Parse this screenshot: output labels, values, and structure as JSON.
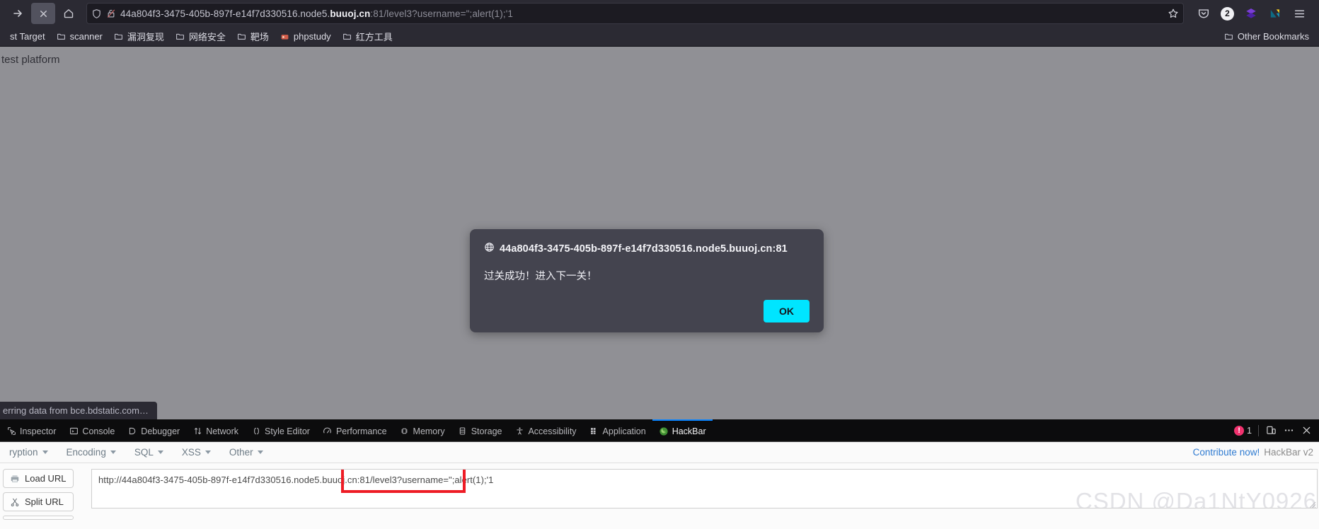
{
  "browser": {
    "nav": {
      "forward_label": "forward",
      "stop_label": "stop",
      "home_label": "home"
    },
    "urlbar": {
      "value": "44a804f3-3475-405b-897f-e14f7d330516.node5.buuoj.cn:81/level3?username=\";alert(1);'1",
      "url_prefix": "44a804f3-3475-405b-897f-e14f7d330516.node5.",
      "url_host_strong": "buuoj.cn",
      "url_suffix": ":81/level3?username=\";alert(1);'1",
      "shield_icon": "shield-icon",
      "lock_icon": "lock-broken-icon",
      "star_icon": "star-icon"
    },
    "toolbar_icons": [
      {
        "name": "pocket-icon",
        "label": "Pocket"
      },
      {
        "name": "extension-badge",
        "label": "2"
      },
      {
        "name": "extension-diamond-icon",
        "label": "Extension"
      },
      {
        "name": "extension-logo-icon",
        "label": "Extension"
      },
      {
        "name": "app-menu-icon",
        "label": "Open application menu"
      }
    ],
    "bookmarks": [
      {
        "label": "st Target",
        "icon": ""
      },
      {
        "label": "scanner",
        "icon": "folder-icon"
      },
      {
        "label": "漏洞复现",
        "icon": "folder-icon"
      },
      {
        "label": "网络安全",
        "icon": "folder-icon"
      },
      {
        "label": "靶场",
        "icon": "folder-icon"
      },
      {
        "label": "phpstudy",
        "icon": "phpstudy-icon"
      },
      {
        "label": "红方工具",
        "icon": "folder-icon"
      }
    ],
    "other_bookmarks": {
      "label": "Other Bookmarks",
      "icon": "folder-icon"
    }
  },
  "page": {
    "title_text": "test platform",
    "background_color": "#909095",
    "status_text": "erring data from bce.bdstatic.com…"
  },
  "dialog": {
    "origin": "44a804f3-3475-405b-897f-e14f7d330516.node5.buuoj.cn:81",
    "globe_icon": "globe-icon",
    "message": "过关成功！进入下一关！",
    "ok_label": "OK",
    "ok_color": "#00e5ff",
    "background_color": "#44444f"
  },
  "devtools": {
    "tabs": [
      {
        "label": "Inspector",
        "icon": "inspector-icon",
        "active": false
      },
      {
        "label": "Console",
        "icon": "console-icon",
        "active": false
      },
      {
        "label": "Debugger",
        "icon": "debugger-icon",
        "active": false
      },
      {
        "label": "Network",
        "icon": "network-icon",
        "active": false
      },
      {
        "label": "Style Editor",
        "icon": "style-editor-icon",
        "active": false
      },
      {
        "label": "Performance",
        "icon": "performance-icon",
        "active": false
      },
      {
        "label": "Memory",
        "icon": "memory-icon",
        "active": false
      },
      {
        "label": "Storage",
        "icon": "storage-icon",
        "active": false
      },
      {
        "label": "Accessibility",
        "icon": "accessibility-icon",
        "active": false
      },
      {
        "label": "Application",
        "icon": "application-icon",
        "active": false
      },
      {
        "label": "HackBar",
        "icon": "hackbar-icon",
        "active": true
      }
    ],
    "error_count": "1",
    "responsive_icon": "responsive-design-mode-icon",
    "meatball_icon": "more-options-icon",
    "close_icon": "close-icon"
  },
  "hackbar": {
    "menu": [
      {
        "label": "ryption",
        "caret": true
      },
      {
        "label": "Encoding",
        "caret": true
      },
      {
        "label": "SQL",
        "caret": true
      },
      {
        "label": "XSS",
        "caret": true
      },
      {
        "label": "Other",
        "caret": true
      }
    ],
    "contribute_label": "Contribute now!",
    "version_label": "HackBar v2",
    "buttons": [
      {
        "label": "Load URL",
        "icon": "load-url-icon"
      },
      {
        "label": "Split URL",
        "icon": "split-url-icon"
      }
    ],
    "url_value": "http://44a804f3-3475-405b-897f-e14f7d330516.node5.buuoj.cn:81/level3?username=\";alert(1);'1",
    "highlight_color": "#ee1c25",
    "watermark": "CSDN @Da1NtY0926"
  }
}
